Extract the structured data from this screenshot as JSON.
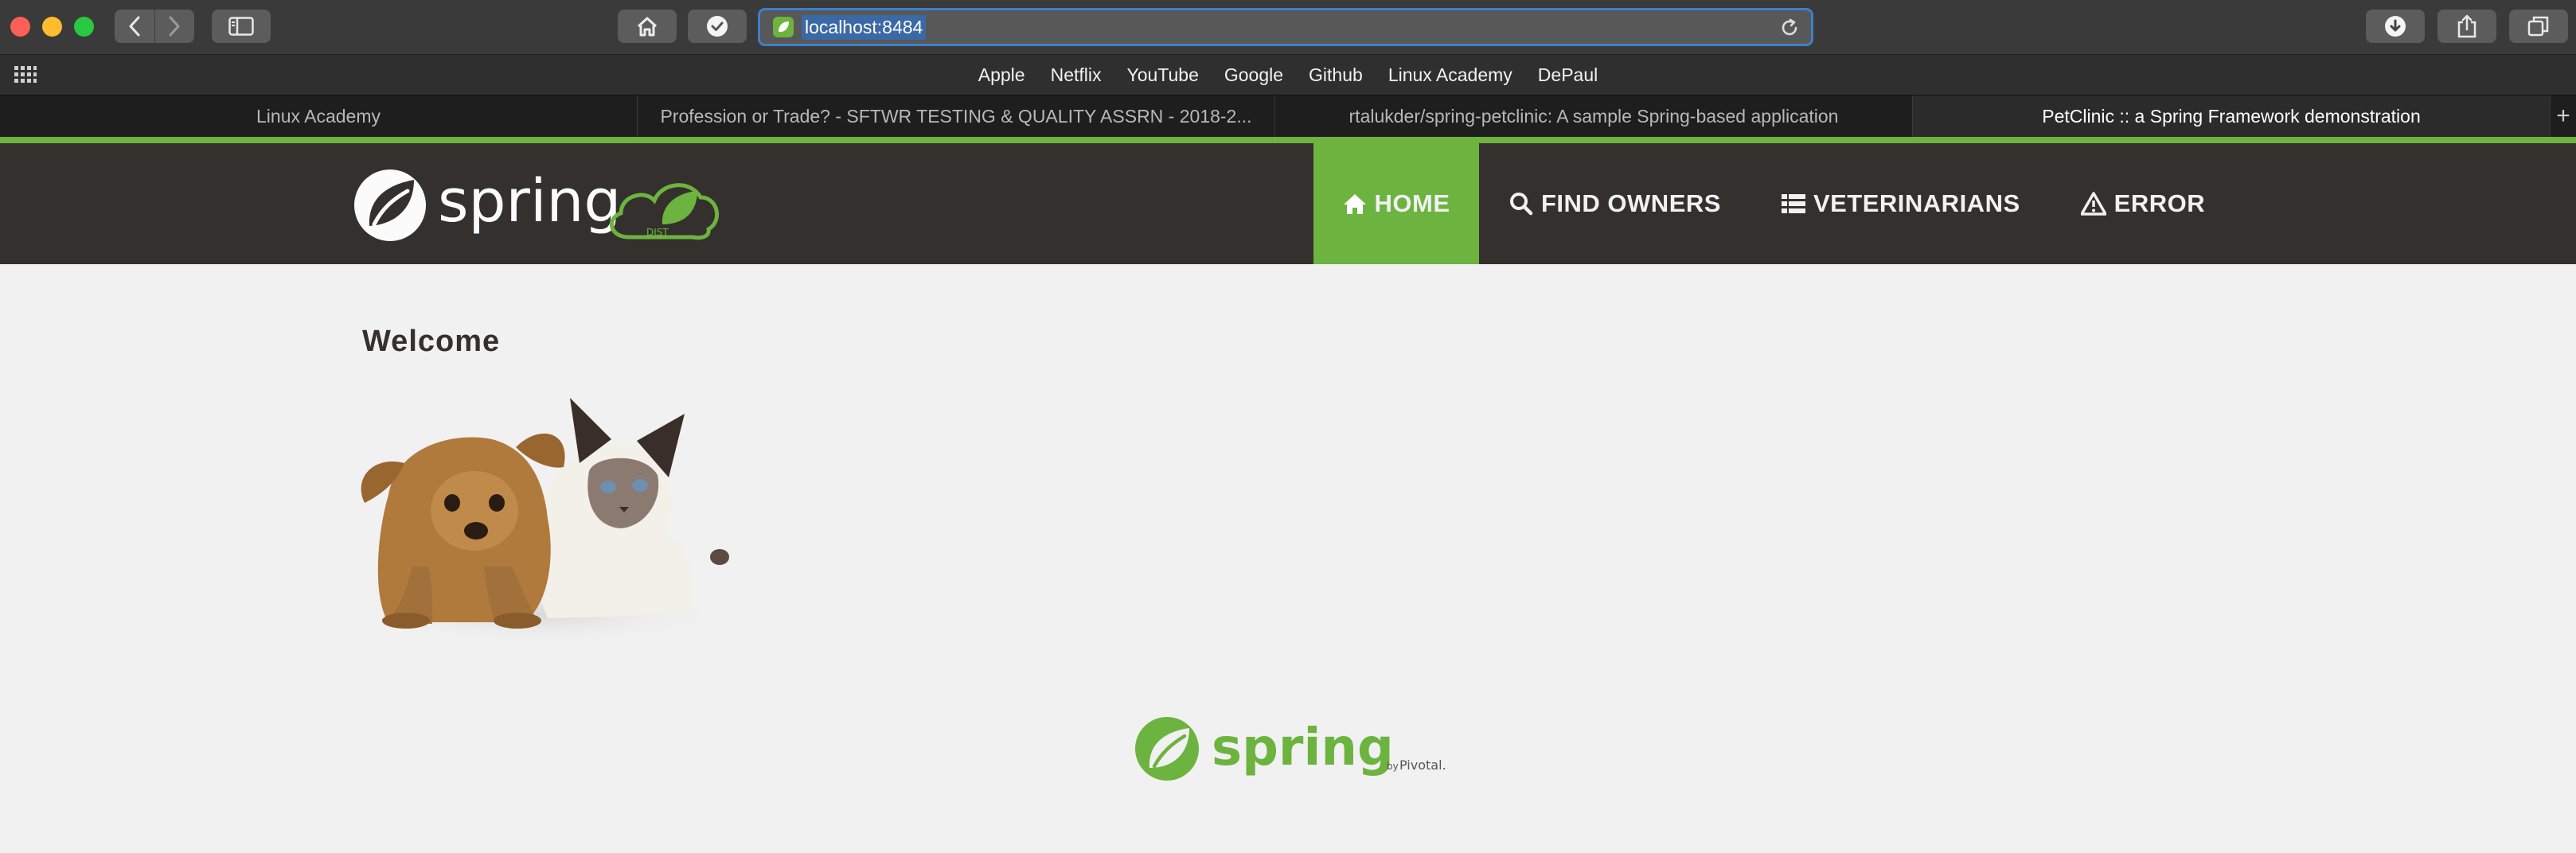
{
  "browser": {
    "url": "localhost:8484",
    "favorites": [
      "Apple",
      "Netflix",
      "YouTube",
      "Google",
      "Github",
      "Linux Academy",
      "DePaul"
    ],
    "tabs": [
      {
        "title": "Linux Academy",
        "active": false
      },
      {
        "title": "Profession or Trade? - SFTWR TESTING & QUALITY ASSRN - 2018-2...",
        "active": false
      },
      {
        "title": "rtalukder/spring-petclinic: A sample Spring-based application",
        "active": false
      },
      {
        "title": "PetClinic :: a Spring Framework demonstration",
        "active": true
      }
    ],
    "new_tab_label": "+",
    "icons": [
      "back-icon",
      "forward-icon",
      "sidebar-icon",
      "home-icon",
      "checkmark-icon",
      "reload-icon",
      "download-icon",
      "share-icon",
      "tabs-icon",
      "apps-grid-icon"
    ]
  },
  "page": {
    "brand": {
      "logo_text": "spring",
      "badge_text": "DIST"
    },
    "nav": [
      {
        "label": "HOME",
        "icon": "home-icon",
        "active": true
      },
      {
        "label": "FIND OWNERS",
        "icon": "search-icon",
        "active": false
      },
      {
        "label": "VETERINARIANS",
        "icon": "list-icon",
        "active": false
      },
      {
        "label": "ERROR",
        "icon": "warning-icon",
        "active": false
      }
    ],
    "welcome": "Welcome",
    "footer": {
      "logo_text": "spring",
      "by_text": "by",
      "pivotal_text": "Pivotal."
    }
  },
  "colors": {
    "spring_green": "#6db33f",
    "navbar_bg": "#34302d",
    "page_bg": "#f1f1f1",
    "url_focus": "#3f7fca"
  }
}
